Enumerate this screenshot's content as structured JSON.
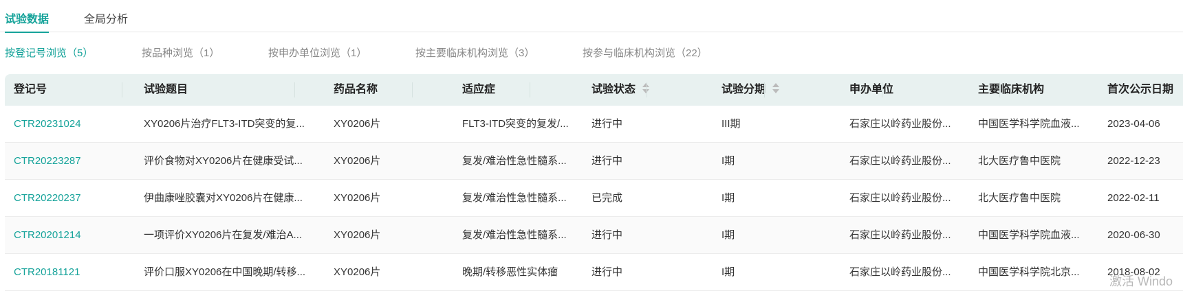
{
  "tabs": [
    {
      "label": "试验数据",
      "active": true
    },
    {
      "label": "全局分析",
      "active": false
    }
  ],
  "subtabs": [
    {
      "label": "按登记号浏览（5）",
      "active": true
    },
    {
      "label": "按品种浏览（1）",
      "active": false
    },
    {
      "label": "按申办单位浏览（1）",
      "active": false
    },
    {
      "label": "按主要临床机构浏览（3）",
      "active": false
    },
    {
      "label": "按参与临床机构浏览（22）",
      "active": false
    }
  ],
  "table": {
    "headers": [
      "登记号",
      "试验题目",
      "药品名称",
      "适应症",
      "试验状态",
      "试验分期",
      "申办单位",
      "主要临床机构",
      "首次公示日期"
    ],
    "sortable": [
      false,
      false,
      false,
      false,
      true,
      true,
      false,
      false,
      false
    ],
    "rows": [
      [
        "CTR20231024",
        "XY0206片治疗FLT3-ITD突变的复...",
        "XY0206片",
        "FLT3-ITD突变的复发/...",
        "进行中",
        "III期",
        "石家庄以岭药业股份...",
        "中国医学科学院血液...",
        "2023-04-06"
      ],
      [
        "CTR20223287",
        "评价食物对XY0206片在健康受试...",
        "XY0206片",
        "复发/难治性急性髓系...",
        "进行中",
        "I期",
        "石家庄以岭药业股份...",
        "北大医疗鲁中医院",
        "2022-12-23"
      ],
      [
        "CTR20220237",
        "伊曲康唑胶囊对XY0206片在健康...",
        "XY0206片",
        "复发/难治性急性髓系...",
        "已完成",
        "I期",
        "石家庄以岭药业股份...",
        "北大医疗鲁中医院",
        "2022-02-11"
      ],
      [
        "CTR20201214",
        "一项评价XY0206片在复发/难治A...",
        "XY0206片",
        "复发/难治性急性髓系...",
        "进行中",
        "I期",
        "石家庄以岭药业股份...",
        "中国医学科学院血液...",
        "2020-06-30"
      ],
      [
        "CTR20181121",
        "评价口服XY0206在中国晚期/转移...",
        "XY0206片",
        "晚期/转移恶性实体瘤",
        "进行中",
        "I期",
        "石家庄以岭药业股份...",
        "中国医学科学院北京...",
        "2018-08-02"
      ]
    ]
  },
  "watermark": "激活 Windo",
  "colors": {
    "accent": "#16a39a",
    "header_bg": "#e8f1f0"
  }
}
